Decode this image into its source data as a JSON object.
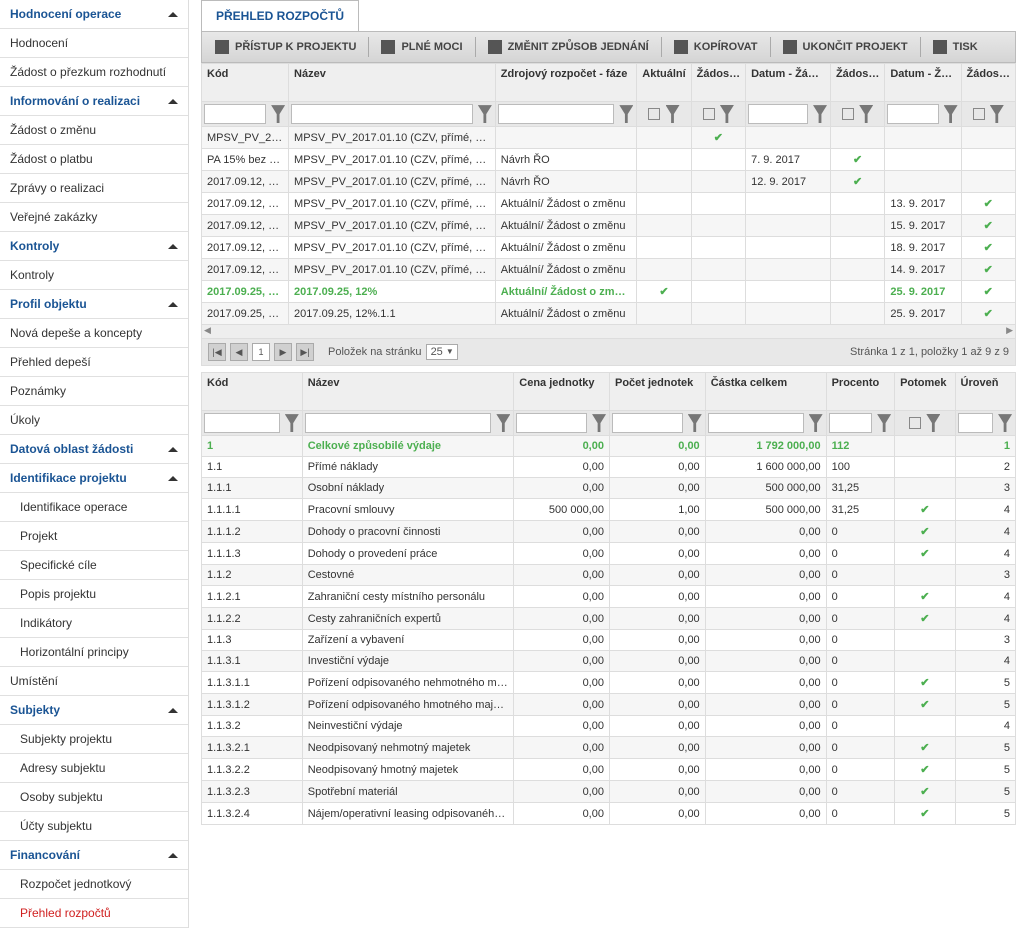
{
  "sidebar": [
    {
      "label": "Hodnocení operace",
      "header": true,
      "chev": true
    },
    {
      "label": "Hodnocení"
    },
    {
      "label": "Žádost o přezkum rozhodnutí"
    },
    {
      "label": "Informování o realizaci",
      "header": true,
      "chev": true
    },
    {
      "label": "Žádost o změnu"
    },
    {
      "label": "Žádost o platbu"
    },
    {
      "label": "Zprávy o realizaci"
    },
    {
      "label": "Veřejné zakázky"
    },
    {
      "label": "Kontroly",
      "header": true,
      "chev": true
    },
    {
      "label": "Kontroly"
    },
    {
      "label": "Profil objektu",
      "header": true,
      "chev": true
    },
    {
      "label": "Nová depeše a koncepty"
    },
    {
      "label": "Přehled depeší"
    },
    {
      "label": "Poznámky"
    },
    {
      "label": "Úkoly"
    },
    {
      "label": "Datová oblast žádosti",
      "header": true,
      "chev": true
    },
    {
      "label": "Identifikace projektu",
      "header": true,
      "chev": true
    },
    {
      "label": "Identifikace operace",
      "indent": true
    },
    {
      "label": "Projekt",
      "indent": true
    },
    {
      "label": "Specifické cíle",
      "indent": true
    },
    {
      "label": "Popis projektu",
      "indent": true
    },
    {
      "label": "Indikátory",
      "indent": true
    },
    {
      "label": "Horizontální principy",
      "indent": true
    },
    {
      "label": "Umístění"
    },
    {
      "label": "Subjekty",
      "header": true,
      "chev": true
    },
    {
      "label": "Subjekty projektu",
      "indent": true
    },
    {
      "label": "Adresy subjektu",
      "indent": true
    },
    {
      "label": "Osoby subjektu",
      "indent": true
    },
    {
      "label": "Účty subjektu",
      "indent": true
    },
    {
      "label": "Financování",
      "header": true,
      "chev": true
    },
    {
      "label": "Rozpočet jednotkový",
      "indent": true
    },
    {
      "label": "Přehled rozpočtů",
      "active": true
    }
  ],
  "tab_title": "PŘEHLED ROZPOČTŮ",
  "toolbar": [
    "PŘÍSTUP K PROJEKTU",
    "PLNÉ MOCI",
    "ZMĚNIT ZPŮSOB JEDNÁNÍ",
    "KOPÍROVAT",
    "UKONČIT PROJEKT",
    "TISK"
  ],
  "grid1": {
    "headers": [
      "Kód",
      "Název",
      "Zdrojový rozpočet - fáze",
      "Aktuální",
      "Žádost o podporu",
      "Datum - Žádost o podporu - změna",
      "Žádost o podporu - změna",
      "Datum - Žádost o změnu",
      "Žádost o změnu"
    ],
    "rows": [
      {
        "kod": "MPSV_PV_20…",
        "nazev": "MPSV_PV_2017.01.10 (CZV, přímé, nepří…",
        "faze": "",
        "akt": false,
        "zop": true,
        "dzpz": "",
        "zpz": false,
        "dzz": "",
        "zz": false
      },
      {
        "kod": "PA 15% bez fi…",
        "nazev": "MPSV_PV_2017.01.10 (CZV, přímé, nepří…",
        "faze": "Návrh ŘO",
        "akt": false,
        "zop": false,
        "dzpz": "7. 9. 2017",
        "zpz": true,
        "dzz": "",
        "zz": false
      },
      {
        "kod": "2017.09.12, 0…",
        "nazev": "MPSV_PV_2017.01.10 (CZV, přímé, nepří…",
        "faze": "Návrh ŘO",
        "akt": false,
        "zop": false,
        "dzpz": "12. 9. 2017",
        "zpz": true,
        "dzz": "",
        "zz": false
      },
      {
        "kod": "2017.09.12, 0…",
        "nazev": "MPSV_PV_2017.01.10 (CZV, přímé, nepří…",
        "faze": "Aktuální/ Žádost o změnu",
        "akt": false,
        "zop": false,
        "dzpz": "",
        "zpz": false,
        "dzz": "13. 9. 2017",
        "zz": true
      },
      {
        "kod": "2017.09.12, 0…",
        "nazev": "MPSV_PV_2017.01.10 (CZV, přímé, nepří…",
        "faze": "Aktuální/ Žádost o změnu",
        "akt": false,
        "zop": false,
        "dzpz": "",
        "zpz": false,
        "dzz": "15. 9. 2017",
        "zz": true
      },
      {
        "kod": "2017.09.12, 0…",
        "nazev": "MPSV_PV_2017.01.10 (CZV, přímé, nepří…",
        "faze": "Aktuální/ Žádost o změnu",
        "akt": false,
        "zop": false,
        "dzpz": "",
        "zpz": false,
        "dzz": "18. 9. 2017",
        "zz": true
      },
      {
        "kod": "2017.09.12, 0…",
        "nazev": "MPSV_PV_2017.01.10 (CZV, přímé, nepří…",
        "faze": "Aktuální/ Žádost o změnu",
        "akt": false,
        "zop": false,
        "dzpz": "",
        "zpz": false,
        "dzz": "14. 9. 2017",
        "zz": true
      },
      {
        "kod": "2017.09.25, 1…",
        "nazev": "2017.09.25, 12%",
        "faze": "Aktuální/ Žádost o změnu",
        "akt": true,
        "zop": false,
        "dzpz": "",
        "zpz": false,
        "dzz": "25. 9. 2017",
        "zz": true,
        "hl": true,
        "mark": true
      },
      {
        "kod": "2017.09.25, 1…",
        "nazev": "2017.09.25, 12%.1.1",
        "faze": "Aktuální/ Žádost o změnu",
        "akt": false,
        "zop": false,
        "dzpz": "",
        "zpz": false,
        "dzz": "25. 9. 2017",
        "zz": true
      }
    ]
  },
  "pager": {
    "page": "1",
    "perpage_label": "Položek na stránku",
    "perpage": "25",
    "summary": "Stránka 1 z 1, položky 1 až 9 z 9"
  },
  "grid2": {
    "headers": [
      "Kód",
      "Název",
      "Cena jednotky",
      "Počet jednotek",
      "Částka celkem",
      "Procento",
      "Potomek",
      "Úroveň"
    ],
    "rows": [
      {
        "kod": "1",
        "nazev": "Celkové způsobilé výdaje",
        "cj": "0,00",
        "pj": "0,00",
        "cc": "1 792 000,00",
        "pr": "112",
        "pot": false,
        "ur": "1",
        "hl": true
      },
      {
        "kod": "1.1",
        "nazev": "Přímé náklady",
        "cj": "0,00",
        "pj": "0,00",
        "cc": "1 600 000,00",
        "pr": "100",
        "pot": false,
        "ur": "2"
      },
      {
        "kod": "1.1.1",
        "nazev": "Osobní náklady",
        "cj": "0,00",
        "pj": "0,00",
        "cc": "500 000,00",
        "pr": "31,25",
        "pot": false,
        "ur": "3"
      },
      {
        "kod": "1.1.1.1",
        "nazev": "Pracovní smlouvy",
        "cj": "500 000,00",
        "pj": "1,00",
        "cc": "500 000,00",
        "pr": "31,25",
        "pot": true,
        "ur": "4"
      },
      {
        "kod": "1.1.1.2",
        "nazev": "Dohody o pracovní činnosti",
        "cj": "0,00",
        "pj": "0,00",
        "cc": "0,00",
        "pr": "0",
        "pot": true,
        "ur": "4"
      },
      {
        "kod": "1.1.1.3",
        "nazev": "Dohody o provedení práce",
        "cj": "0,00",
        "pj": "0,00",
        "cc": "0,00",
        "pr": "0",
        "pot": true,
        "ur": "4"
      },
      {
        "kod": "1.1.2",
        "nazev": "Cestovné",
        "cj": "0,00",
        "pj": "0,00",
        "cc": "0,00",
        "pr": "0",
        "pot": false,
        "ur": "3"
      },
      {
        "kod": "1.1.2.1",
        "nazev": "Zahraniční cesty místního personálu",
        "cj": "0,00",
        "pj": "0,00",
        "cc": "0,00",
        "pr": "0",
        "pot": true,
        "ur": "4"
      },
      {
        "kod": "1.1.2.2",
        "nazev": "Cesty zahraničních expertů",
        "cj": "0,00",
        "pj": "0,00",
        "cc": "0,00",
        "pr": "0",
        "pot": true,
        "ur": "4"
      },
      {
        "kod": "1.1.3",
        "nazev": "Zařízení a vybavení",
        "cj": "0,00",
        "pj": "0,00",
        "cc": "0,00",
        "pr": "0",
        "pot": false,
        "ur": "3"
      },
      {
        "kod": "1.1.3.1",
        "nazev": "Investiční výdaje",
        "cj": "0,00",
        "pj": "0,00",
        "cc": "0,00",
        "pr": "0",
        "pot": false,
        "ur": "4"
      },
      {
        "kod": "1.1.3.1.1",
        "nazev": "Pořízení odpisovaného nehmotného maje…",
        "cj": "0,00",
        "pj": "0,00",
        "cc": "0,00",
        "pr": "0",
        "pot": true,
        "ur": "5"
      },
      {
        "kod": "1.1.3.1.2",
        "nazev": "Pořízení odpisovaného hmotného majetku",
        "cj": "0,00",
        "pj": "0,00",
        "cc": "0,00",
        "pr": "0",
        "pot": true,
        "ur": "5"
      },
      {
        "kod": "1.1.3.2",
        "nazev": "Neinvestiční výdaje",
        "cj": "0,00",
        "pj": "0,00",
        "cc": "0,00",
        "pr": "0",
        "pot": false,
        "ur": "4"
      },
      {
        "kod": "1.1.3.2.1",
        "nazev": "Neodpisovaný nehmotný majetek",
        "cj": "0,00",
        "pj": "0,00",
        "cc": "0,00",
        "pr": "0",
        "pot": true,
        "ur": "5"
      },
      {
        "kod": "1.1.3.2.2",
        "nazev": "Neodpisovaný hmotný majetek",
        "cj": "0,00",
        "pj": "0,00",
        "cc": "0,00",
        "pr": "0",
        "pot": true,
        "ur": "5"
      },
      {
        "kod": "1.1.3.2.3",
        "nazev": "Spotřební materiál",
        "cj": "0,00",
        "pj": "0,00",
        "cc": "0,00",
        "pr": "0",
        "pot": true,
        "ur": "5"
      },
      {
        "kod": "1.1.3.2.4",
        "nazev": "Nájem/operativní leasing odpisovanéh…",
        "cj": "0,00",
        "pj": "0,00",
        "cc": "0,00",
        "pr": "0",
        "pot": true,
        "ur": "5"
      }
    ]
  }
}
